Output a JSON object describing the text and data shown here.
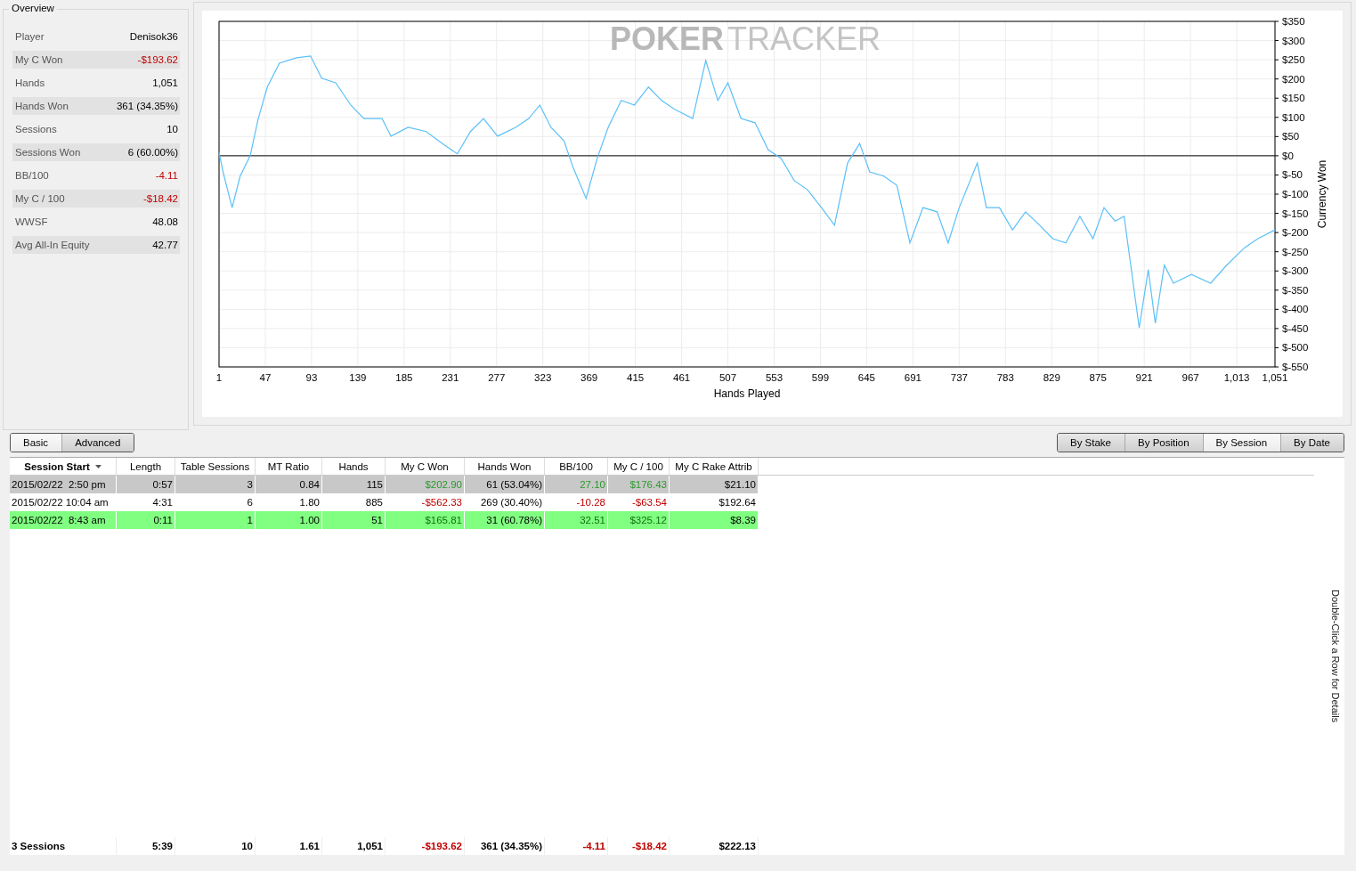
{
  "overview": {
    "title": "Overview",
    "rows": [
      {
        "label": "Player",
        "value": "Denisok36"
      },
      {
        "label": "My C Won",
        "value": "-$193.62",
        "color": "#c00000"
      },
      {
        "label": "Hands",
        "value": "1,051"
      },
      {
        "label": "Hands Won",
        "value": "361 (34.35%)"
      },
      {
        "label": "Sessions",
        "value": "10"
      },
      {
        "label": "Sessions Won",
        "value": "6 (60.00%)"
      },
      {
        "label": "BB/100",
        "value": "-4.11",
        "color": "#c00000"
      },
      {
        "label": "My C / 100",
        "value": "-$18.42",
        "color": "#c00000"
      },
      {
        "label": "WWSF",
        "value": "48.08"
      },
      {
        "label": "Avg All-In Equity",
        "value": "42.77"
      }
    ]
  },
  "chart": {
    "watermark": {
      "strong": "POKER",
      "light": "TRACKER"
    },
    "chart_data": {
      "type": "line",
      "grid": true,
      "xlabel": "Hands Played",
      "ylabel": "Currency Won",
      "xlim": [
        1,
        1051
      ],
      "ylim": [
        -550,
        350
      ],
      "x": [
        1,
        5,
        14,
        22,
        32,
        40,
        49,
        61,
        78,
        92,
        103,
        117,
        132,
        145,
        163,
        172,
        189,
        207,
        225,
        238,
        251,
        264,
        278,
        296,
        309,
        320,
        331,
        344,
        353,
        366,
        377,
        388,
        401,
        414,
        428,
        441,
        454,
        472,
        485,
        497,
        507,
        520,
        534,
        547,
        560,
        573,
        586,
        600,
        613,
        626,
        638,
        648,
        662,
        675,
        688,
        701,
        715,
        726,
        737,
        755,
        764,
        777,
        790,
        803,
        817,
        830,
        843,
        857,
        870,
        881,
        892,
        901,
        907,
        916,
        925,
        932,
        941,
        950,
        968,
        987,
        1003,
        1021,
        1034,
        1051
      ],
      "series": [
        {
          "color": "#5bc0f8",
          "values": [
            9,
            -42,
            -135,
            -53,
            0,
            97,
            179,
            241,
            255,
            260,
            202,
            190,
            132,
            97,
            97,
            51,
            74,
            63,
            28,
            5,
            63,
            97,
            51,
            74,
            97,
            132,
            74,
            39,
            -30,
            -111,
            -7,
            74,
            144,
            132,
            179,
            144,
            121,
            97,
            248,
            144,
            190,
            97,
            86,
            16,
            -7,
            -65,
            -88,
            -135,
            -181,
            -19,
            32,
            -42,
            -53,
            -77,
            -227,
            -135,
            -146,
            -227,
            -135,
            -19,
            -135,
            -135,
            -193,
            -146,
            -181,
            -216,
            -227,
            -158,
            -216,
            -135,
            -170,
            -158,
            -274,
            -448,
            -297,
            -436,
            -285,
            -332,
            -309,
            -332,
            -285,
            -239,
            -216,
            -193
          ]
        }
      ],
      "xticks": [
        1,
        47,
        93,
        139,
        185,
        231,
        277,
        323,
        369,
        415,
        461,
        507,
        553,
        599,
        645,
        691,
        737,
        783,
        829,
        875,
        921,
        967,
        {
          "value": 1013,
          "label": "1,013"
        },
        {
          "value": 1051,
          "label": "1,051"
        }
      ],
      "yticks": [
        {
          "value": 350,
          "label": "$350"
        },
        {
          "value": 300,
          "label": "$300"
        },
        {
          "value": 250,
          "label": "$250"
        },
        {
          "value": 200,
          "label": "$200"
        },
        {
          "value": 150,
          "label": "$150"
        },
        {
          "value": 100,
          "label": "$100"
        },
        {
          "value": 50,
          "label": "$50"
        },
        {
          "value": 0,
          "label": "$0"
        },
        {
          "value": -50,
          "label": "$-50"
        },
        {
          "value": -100,
          "label": "$-100"
        },
        {
          "value": -150,
          "label": "$-150"
        },
        {
          "value": -200,
          "label": "$-200"
        },
        {
          "value": -250,
          "label": "$-250"
        },
        {
          "value": -300,
          "label": "$-300"
        },
        {
          "value": -350,
          "label": "$-350"
        },
        {
          "value": -400,
          "label": "$-400"
        },
        {
          "value": -450,
          "label": "$-450"
        },
        {
          "value": -500,
          "label": "$-500"
        },
        {
          "value": -550,
          "label": "$-550"
        }
      ]
    }
  },
  "view_tabs": [
    {
      "label": "Basic",
      "selected": true
    },
    {
      "label": "Advanced",
      "selected": false
    }
  ],
  "group_tabs": [
    {
      "label": "By Stake",
      "selected": false
    },
    {
      "label": "By Position",
      "selected": false
    },
    {
      "label": "By Session",
      "selected": true
    },
    {
      "label": "By Date",
      "selected": false
    }
  ],
  "table": {
    "columns": [
      {
        "label": "Session Start",
        "sorted": true
      },
      {
        "label": "Length",
        "sorted": false
      },
      {
        "label": "Table Sessions",
        "sorted": false
      },
      {
        "label": "MT Ratio",
        "sorted": false
      },
      {
        "label": "Hands",
        "sorted": false
      },
      {
        "label": "My C Won",
        "sorted": false
      },
      {
        "label": "Hands Won",
        "sorted": false
      },
      {
        "label": "BB/100",
        "sorted": false
      },
      {
        "label": "My C / 100",
        "sorted": false
      },
      {
        "label": "My C Rake Attrib",
        "sorted": false
      }
    ],
    "rows": [
      {
        "color": "#c8c8c8",
        "cells": [
          {
            "text": "2015/02/22  2:50 pm"
          },
          {
            "text": "0:57"
          },
          {
            "text": "3"
          },
          {
            "text": "0.84"
          },
          {
            "text": "115"
          },
          {
            "text": "$202.90",
            "color": "#2a9a2a"
          },
          {
            "text": "61 (53.04%)"
          },
          {
            "text": "27.10",
            "color": "#2a9a2a"
          },
          {
            "text": "$176.43",
            "color": "#2a9a2a"
          },
          {
            "text": "$21.10"
          }
        ]
      },
      {
        "color": "#ffffff",
        "cells": [
          {
            "text": "2015/02/22 10:04 am"
          },
          {
            "text": "4:31"
          },
          {
            "text": "6"
          },
          {
            "text": "1.80"
          },
          {
            "text": "885"
          },
          {
            "text": "-$562.33",
            "color": "#c00000"
          },
          {
            "text": "269 (30.40%)"
          },
          {
            "text": "-10.28",
            "color": "#c00000"
          },
          {
            "text": "-$63.54",
            "color": "#c00000"
          },
          {
            "text": "$192.64"
          }
        ]
      },
      {
        "color": "#80ff80",
        "cells": [
          {
            "text": "2015/02/22  8:43 am"
          },
          {
            "text": "0:11"
          },
          {
            "text": "1"
          },
          {
            "text": "1.00"
          },
          {
            "text": "51"
          },
          {
            "text": "$165.81",
            "color": "#107010"
          },
          {
            "text": "31 (60.78%)"
          },
          {
            "text": "32.51",
            "color": "#107010"
          },
          {
            "text": "$325.12",
            "color": "#107010"
          },
          {
            "text": "$8.39"
          }
        ]
      }
    ],
    "totals": [
      {
        "text": "3 Sessions"
      },
      {
        "text": "5:39"
      },
      {
        "text": "10"
      },
      {
        "text": "1.61"
      },
      {
        "text": "1,051"
      },
      {
        "text": "-$193.62",
        "color": "#c00000"
      },
      {
        "text": "361 (34.35%)"
      },
      {
        "text": "-4.11",
        "color": "#c00000"
      },
      {
        "text": "-$18.42",
        "color": "#c00000"
      },
      {
        "text": "$222.13"
      }
    ]
  },
  "hint": "Double-Click a Row for Details"
}
